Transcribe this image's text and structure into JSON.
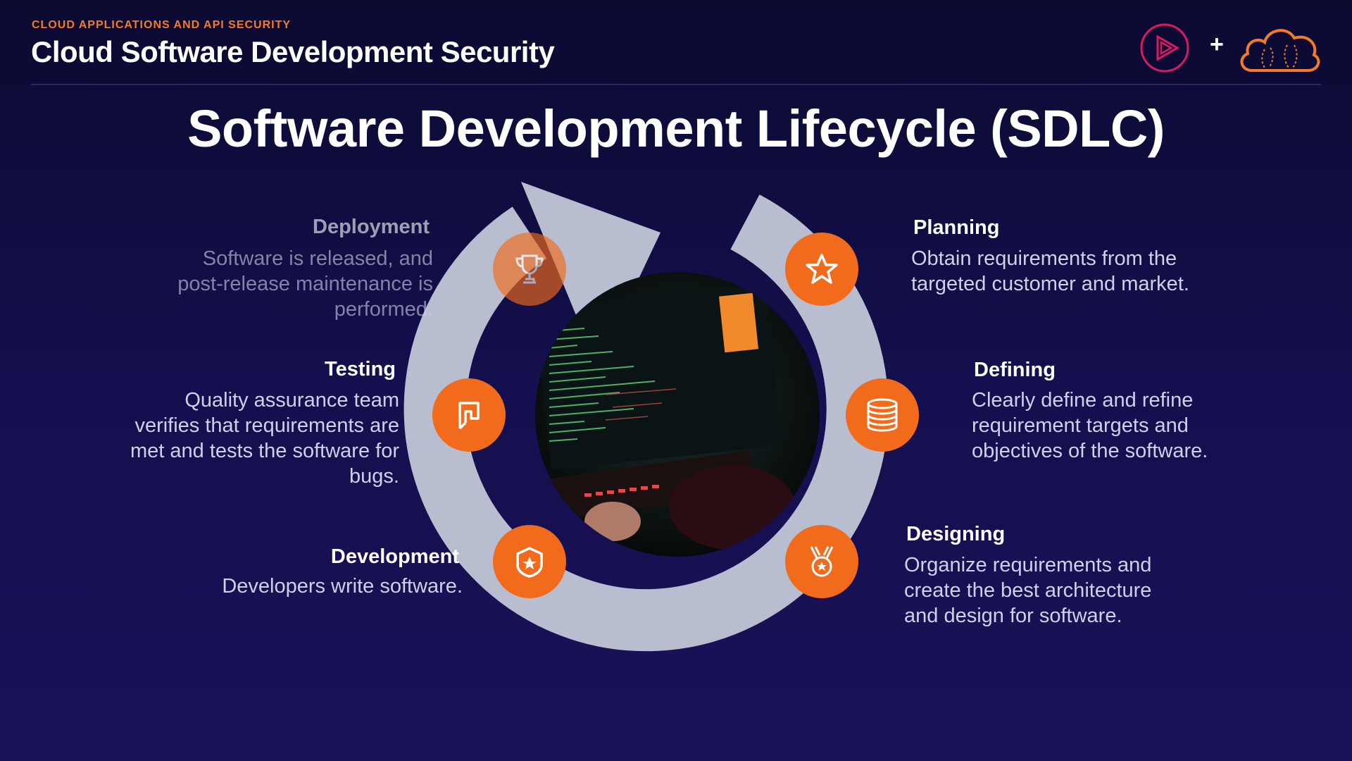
{
  "header": {
    "eyebrow": "CLOUD APPLICATIONS AND API SECURITY",
    "course_title": "Cloud Software Development Security",
    "logo_separator": "+"
  },
  "slide": {
    "title": "Software Development Lifecycle (SDLC)"
  },
  "stages": {
    "planning": {
      "name": "Planning",
      "desc_lines": [
        "Obtain requirements from the",
        "targeted customer and market."
      ],
      "icon": "star-icon"
    },
    "defining": {
      "name": "Defining",
      "desc_lines": [
        "Clearly define and refine",
        "requirement targets and",
        "objectives of the software."
      ],
      "icon": "database-icon"
    },
    "designing": {
      "name": "Designing",
      "desc_lines": [
        "Organize requirements and",
        "create the best architecture",
        "and design for software."
      ],
      "icon": "medal-icon"
    },
    "development": {
      "name": "Development",
      "desc_lines": [
        "Developers write software."
      ],
      "icon": "shield-star-icon"
    },
    "testing": {
      "name": "Testing",
      "desc_lines": [
        "Quality assurance team",
        "verifies that requirements are",
        "met and tests the software for",
        "bugs."
      ],
      "icon": "flag-icon"
    },
    "deployment": {
      "name": "Deployment",
      "desc_lines": [
        "Software is released, and",
        "post-release maintenance is",
        "performed."
      ],
      "icon": "trophy-icon"
    }
  },
  "colors": {
    "accent": "#f26a1b",
    "ring": "#b8bed0",
    "background": "#140f4e"
  }
}
